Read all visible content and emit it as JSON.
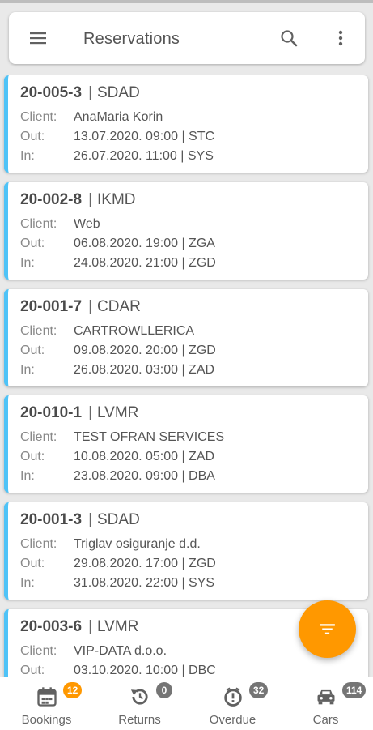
{
  "header": {
    "title": "Reservations",
    "menu_icon": "menu-icon",
    "search_icon": "search-icon",
    "more_icon": "more-vert-icon"
  },
  "labels": {
    "client": "Client:",
    "out": "Out:",
    "in": "In:",
    "separator": "|"
  },
  "reservations": [
    {
      "code": "20-005-3",
      "group": "SDAD",
      "client": "AnaMaria Korin",
      "out": "13.07.2020. 09:00 | STC",
      "in": "26.07.2020. 11:00 | SYS"
    },
    {
      "code": "20-002-8",
      "group": "IKMD",
      "client": "Web",
      "out": "06.08.2020. 19:00 | ZGA",
      "in": "24.08.2020. 21:00 | ZGD"
    },
    {
      "code": "20-001-7",
      "group": "CDAR",
      "client": "CARTROWLLERICA",
      "out": "09.08.2020. 20:00 | ZGD",
      "in": "26.08.2020. 03:00 | ZAD"
    },
    {
      "code": "20-010-1",
      "group": "LVMR",
      "client": "TEST OFRAN SERVICES",
      "out": "10.08.2020. 05:00 | ZAD",
      "in": "23.08.2020. 09:00 | DBA"
    },
    {
      "code": "20-001-3",
      "group": "SDAD",
      "client": "Triglav osiguranje d.d.",
      "out": "29.08.2020. 17:00 | ZGD",
      "in": "31.08.2020. 22:00 | SYS"
    },
    {
      "code": "20-003-6",
      "group": "LVMR",
      "client": "VIP-DATA d.o.o.",
      "out": "03.10.2020. 10:00 | DBC",
      "in": ""
    }
  ],
  "fab": {
    "icon": "filter-icon",
    "color": "#ff9800"
  },
  "bottom_nav": [
    {
      "label": "Bookings",
      "icon": "calendar-icon",
      "badge": "12",
      "badge_color": "#ff9800"
    },
    {
      "label": "Returns",
      "icon": "history-icon",
      "badge": "0",
      "badge_color": "#757575"
    },
    {
      "label": "Overdue",
      "icon": "alarm-alert-icon",
      "badge": "32",
      "badge_color": "#757575"
    },
    {
      "label": "Cars",
      "icon": "car-icon",
      "badge": "114",
      "badge_color": "#757575"
    }
  ],
  "colors": {
    "accent": "#4fc3f7",
    "fab": "#ff9800",
    "background": "#e9e9e9"
  }
}
